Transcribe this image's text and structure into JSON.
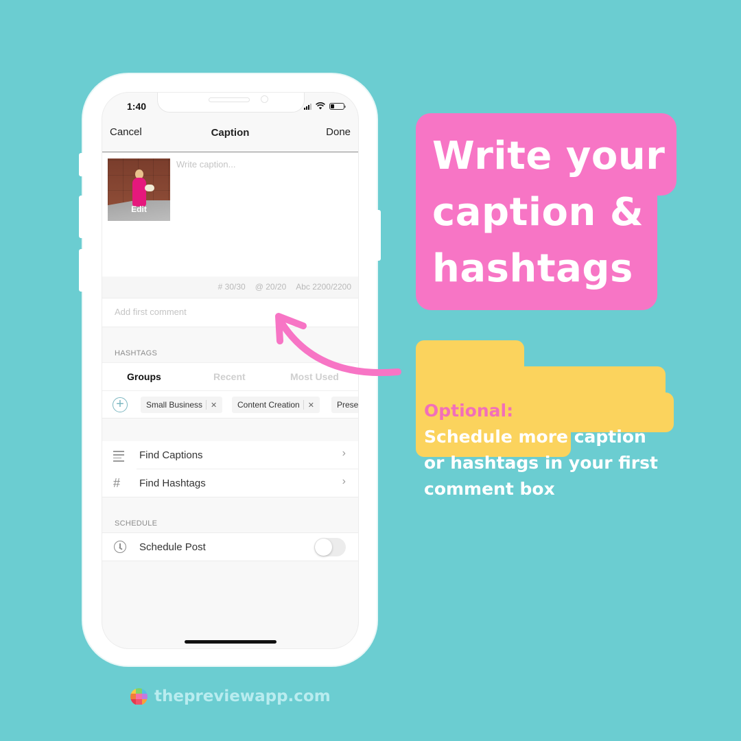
{
  "status_bar": {
    "time": "1:40"
  },
  "nav": {
    "cancel": "Cancel",
    "title": "Caption",
    "done": "Done"
  },
  "caption": {
    "thumbnail_action": "Edit",
    "placeholder": "Write caption...",
    "value": ""
  },
  "counters": {
    "hashtags": "# 30/30",
    "mentions": "@ 20/20",
    "characters": "Abc 2200/2200"
  },
  "first_comment": {
    "placeholder": "Add first comment",
    "value": ""
  },
  "hashtags": {
    "section_label": "HASHTAGS",
    "tabs": [
      {
        "label": "Groups",
        "active": true
      },
      {
        "label": "Recent",
        "active": false
      },
      {
        "label": "Most Used",
        "active": false
      }
    ],
    "groups": [
      {
        "label": "Small Business"
      },
      {
        "label": "Content Creation"
      },
      {
        "label": "Preset"
      }
    ]
  },
  "tools": [
    {
      "label": "Find Captions",
      "icon": "lines-icon"
    },
    {
      "label": "Find Hashtags",
      "icon": "hash-icon"
    }
  ],
  "schedule": {
    "section_label": "SCHEDULE",
    "item_label": "Schedule Post",
    "enabled": false
  },
  "callouts": {
    "headline": "Write your\ncaption &\nhashtags",
    "optional_label": "Optional:",
    "optional_text": "Schedule more caption\nor hashtags in your first\ncomment box"
  },
  "footer": {
    "site": "thepreviewapp.com"
  },
  "colors": {
    "background": "#6bcdd1",
    "pink": "#f775c5",
    "yellow": "#fbd35d",
    "optional_label": "#f26fb9",
    "footer_text": "#b9ecef"
  }
}
